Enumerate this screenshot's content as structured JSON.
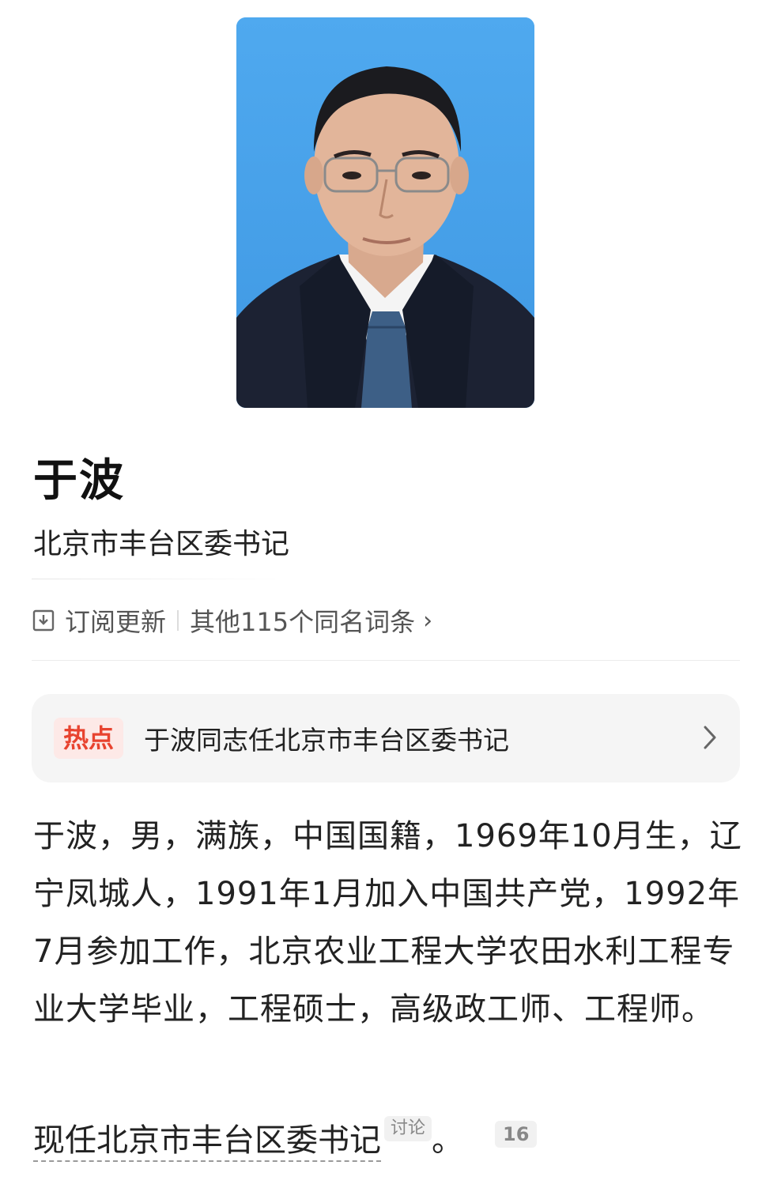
{
  "portrait": {
    "alt": "于波"
  },
  "header": {
    "name": "于波",
    "subtitle": "北京市丰台区委书记"
  },
  "actions": {
    "subscribe_icon": "subscribe-icon",
    "subscribe_label": "订阅更新",
    "same_name_label": "其他115个同名词条",
    "chevron": "›"
  },
  "hot": {
    "tag": "热点",
    "text": "于波同志任北京市丰台区委书记"
  },
  "bio": {
    "paragraph": "于波，男，满族，中国国籍，1969年10月生，辽宁凤城人，1991年1月加入中国共产党，1992年7月参加工作，北京农业工程大学农田水利工程专业大学毕业，工程硕士，高级政工师、工程师。"
  },
  "current": {
    "link_text": "现任北京市丰台区委书记",
    "discuss_badge": "讨论",
    "tail": "。",
    "ref_count": "16"
  },
  "colors": {
    "hot_tag_text": "#e8432f",
    "hot_tag_bg": "#fde9e7",
    "photo_bg": "#4aa3ec"
  }
}
